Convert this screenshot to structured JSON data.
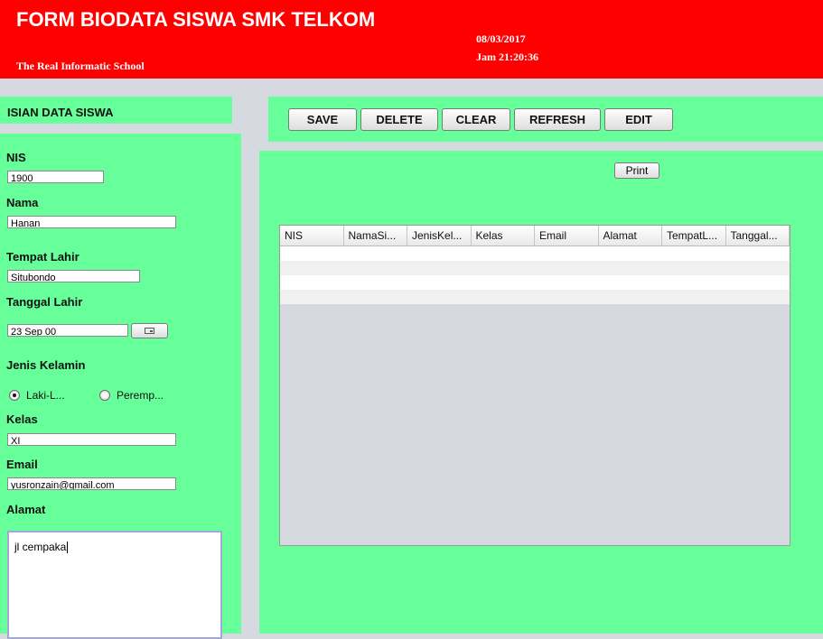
{
  "header": {
    "title": "FORM BIODATA SISWA SMK TELKOM",
    "tagline": "The Real Informatic School",
    "date": "08/03/2017",
    "time": "Jam 21:20:36",
    "background_color": "#ff0000"
  },
  "form": {
    "section_title": "ISIAN DATA SISWA",
    "panel_color": "#66ff99",
    "nis": {
      "label": "NIS",
      "value": "1900"
    },
    "nama": {
      "label": "Nama",
      "value": "Hanan"
    },
    "tempat_lahir": {
      "label": "Tempat Lahir",
      "value": "Situbondo"
    },
    "tanggal_lahir": {
      "label": "Tanggal Lahir",
      "value": "23 Sep 00",
      "picker_icon": "calendar-icon"
    },
    "jenis_kelamin": {
      "label": "Jenis Kelamin",
      "options": [
        {
          "label": "Laki-L...",
          "selected": true
        },
        {
          "label": "Peremp...",
          "selected": false
        }
      ]
    },
    "kelas": {
      "label": "Kelas",
      "value": "XI"
    },
    "email": {
      "label": "Email",
      "value": "yusronzain@gmail.com"
    },
    "alamat": {
      "label": "Alamat",
      "value": "jl cempaka"
    }
  },
  "toolbar": {
    "save": "SAVE",
    "delete": "DELETE",
    "clear": "CLEAR",
    "refresh": "REFRESH",
    "edit": "EDIT",
    "print": "Print"
  },
  "table": {
    "columns": [
      "NIS",
      "NamaSi...",
      "JenisKel...",
      "Kelas",
      "Email",
      "Alamat",
      "TempatL...",
      "Tanggal..."
    ],
    "rows": [
      [],
      [],
      [],
      []
    ]
  }
}
